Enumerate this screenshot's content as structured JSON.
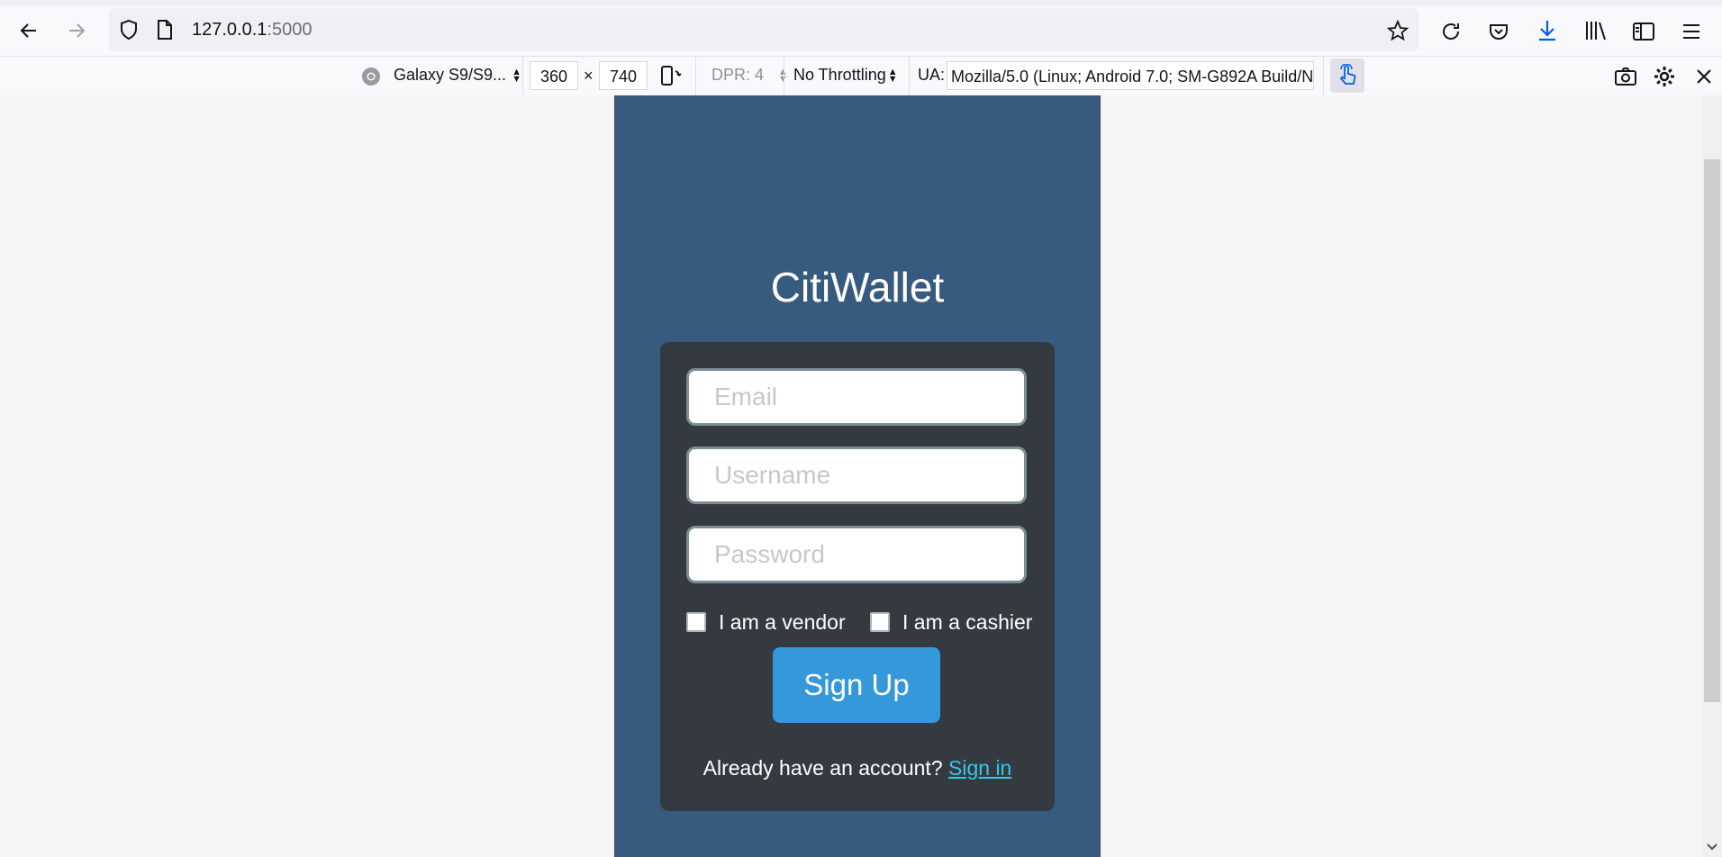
{
  "browser": {
    "url_host": "127.0.0.1",
    "url_port": ":5000"
  },
  "devtools": {
    "device": "Galaxy S9/S9...",
    "width": "360",
    "times": "×",
    "height": "740",
    "dpr": "DPR: 4",
    "throttling": "No Throttling",
    "ua_label": "UA:",
    "ua_value": "Mozilla/5.0 (Linux; Android 7.0; SM-G892A Build/N"
  },
  "page": {
    "title": "CitiWallet",
    "email_placeholder": "Email",
    "username_placeholder": "Username",
    "password_placeholder": "Password",
    "vendor_label": "I am a vendor",
    "cashier_label": "I am a cashier",
    "signup_label": "Sign Up",
    "already_text": "Already have an account?",
    "signin_link": "Sign in"
  },
  "colors": {
    "phone_bg": "#375a7f",
    "card_bg": "#343a40",
    "button": "#3498db",
    "link": "#32c8e8"
  }
}
